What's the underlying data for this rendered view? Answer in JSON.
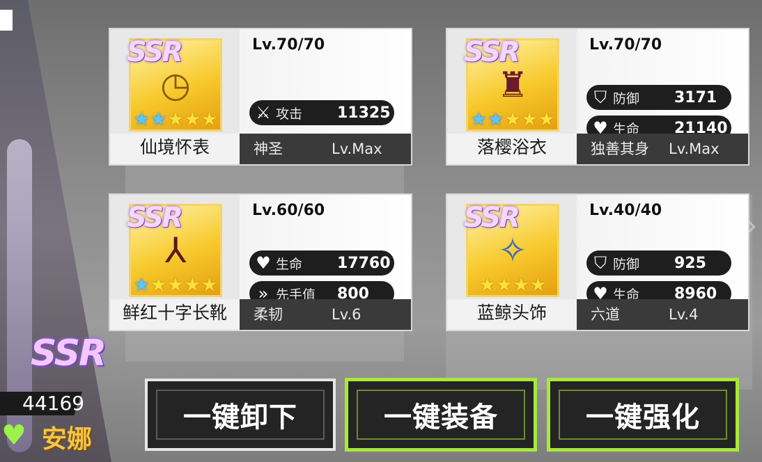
{
  "character": {
    "rarity": "SSR",
    "power": "44169",
    "name": "安娜",
    "element_icon": "heart-wings-icon"
  },
  "equipment": [
    {
      "rarity": "SSR",
      "name": "仙境怀表",
      "icon": "pocket-watch-icon",
      "level": "Lv.70/70",
      "stars_total": 5,
      "stars_blue": 2,
      "stats": [
        {
          "icon": "crossed-swords-icon",
          "name": "攻击",
          "value": "11325"
        }
      ],
      "trait": "神圣",
      "trait_level": "Lv.Max"
    },
    {
      "rarity": "SSR",
      "name": "落樱浴衣",
      "icon": "kimono-icon",
      "level": "Lv.70/70",
      "stars_total": 5,
      "stars_blue": 2,
      "stats": [
        {
          "icon": "shield-icon",
          "name": "防御",
          "value": "3171"
        },
        {
          "icon": "heart-icon",
          "name": "生命",
          "value": "21140"
        }
      ],
      "trait": "独善其身",
      "trait_level": "Lv.Max"
    },
    {
      "rarity": "SSR",
      "name": "鲜红十字长靴",
      "icon": "boots-icon",
      "level": "Lv.60/60",
      "stars_total": 5,
      "stars_blue": 1,
      "stats": [
        {
          "icon": "heart-icon",
          "name": "生命",
          "value": "17760"
        },
        {
          "icon": "boot-speed-icon",
          "name": "先手值",
          "value": "800"
        }
      ],
      "trait": "柔韧",
      "trait_level": "Lv.6"
    },
    {
      "rarity": "SSR",
      "name": "蓝鲸头饰",
      "icon": "whale-headpiece-icon",
      "level": "Lv.40/40",
      "stars_total": 4,
      "stars_blue": 0,
      "stats": [
        {
          "icon": "shield-icon",
          "name": "防御",
          "value": "925"
        },
        {
          "icon": "heart-icon",
          "name": "生命",
          "value": "8960"
        }
      ],
      "trait": "六道",
      "trait_level": "Lv.4"
    }
  ],
  "buttons": {
    "unequip_all": "一键卸下",
    "equip_all": "一键装备",
    "enhance_all": "一键强化"
  },
  "colors": {
    "accent_green": "#a8e83a",
    "star_gold": "#fbe23a",
    "star_blue": "#58c8ff",
    "name_gold": "#f5c542"
  }
}
